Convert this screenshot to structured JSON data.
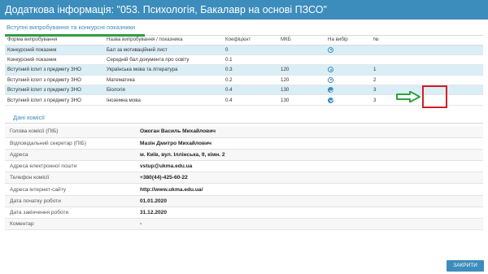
{
  "modal": {
    "title": "Додаткова інформація: \"053. Психологія, Бакалавр на основі ПЗСО\""
  },
  "tabs": {
    "active_label": "Вступні випробування та конкурсні показники"
  },
  "exams": {
    "headers": [
      "Форма випробування",
      "Назва випробування / показника",
      "Коефіцієнт",
      "МКБ",
      "На вибір",
      "№"
    ],
    "rows": [
      {
        "form": "Конкурсний показник",
        "name": "Бал за мотиваційний лист",
        "coef": "0",
        "mkb": "",
        "choice": "empty",
        "num": ""
      },
      {
        "form": "Конкурсний показник",
        "name": "Середній бал документа про освіту",
        "coef": "0.1",
        "mkb": "",
        "choice": "none",
        "num": ""
      },
      {
        "form": "Вступний іспит з предмету ЗНО",
        "name": "Українська мова та література",
        "coef": "0.3",
        "mkb": "120",
        "choice": "empty",
        "num": "1"
      },
      {
        "form": "Вступний іспит з предмету ЗНО",
        "name": "Математика",
        "coef": "0.2",
        "mkb": "120",
        "choice": "empty",
        "num": "2"
      },
      {
        "form": "Вступний іспит з предмету ЗНО",
        "name": "Біологія",
        "coef": "0.4",
        "mkb": "130",
        "choice": "checked",
        "num": "3"
      },
      {
        "form": "Вступний іспит з предмету ЗНО",
        "name": "Іноземна мова",
        "coef": "0.4",
        "mkb": "130",
        "choice": "checked",
        "num": "3"
      }
    ]
  },
  "commission": {
    "section_title": "Дані комісії",
    "rows": [
      {
        "label": "Голова комісії (ПІБ)",
        "value": "Ожоган Василь Михайлович"
      },
      {
        "label": "Відповідальний секретар (ПІБ)",
        "value": "Мазін Дмитро Михайлович"
      },
      {
        "label": "Адреса",
        "value": "м. Київ, вул. Іллінська, 9, кімн. 2"
      },
      {
        "label": "Адреса електронної пошти",
        "value": "vstup@ukma.edu.ua"
      },
      {
        "label": "Телефон комісії",
        "value": "+380(44)-425-60-22"
      },
      {
        "label": "Адреса інтернет-сайту",
        "value": "http://www.ukma.edu.ua/"
      },
      {
        "label": "Дата початку роботи",
        "value": "01.01.2020"
      },
      {
        "label": "Дата закінчення роботи",
        "value": "31.12.2020"
      },
      {
        "label": "Коментар",
        "value": "-"
      }
    ]
  },
  "footer": {
    "close_label": "ЗАКРИТИ"
  },
  "colors": {
    "accent": "#3c8dbc",
    "tab_underline": "#2e9e44",
    "highlight": "#d21f25",
    "arrow": "#2ea43f",
    "row_alt": "#d9eef6"
  },
  "icons": {
    "checked": "check-circle-icon",
    "empty": "radio-circle-icon"
  }
}
